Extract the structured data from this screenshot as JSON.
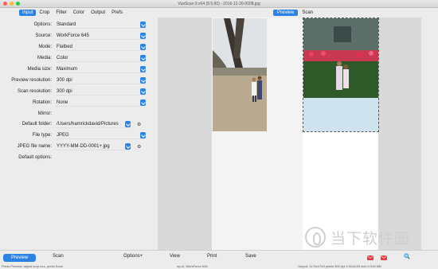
{
  "window": {
    "title": "VueScan 9 x64 (9.5.60) - 2016-12-26-0008.jpg"
  },
  "left_tabs": [
    "Input",
    "Crop",
    "Filter",
    "Color",
    "Output",
    "Prefs"
  ],
  "right_tabs": [
    "Preview",
    "Scan"
  ],
  "fields": [
    {
      "label": "Options:",
      "value": "Standard"
    },
    {
      "label": "Source:",
      "value": "WorkForce 645"
    },
    {
      "label": "Mode:",
      "value": "Flatbed"
    },
    {
      "label": "Media:",
      "value": "Color"
    },
    {
      "label": "Media size:",
      "value": "Maximum"
    },
    {
      "label": "Preview resolution:",
      "value": "300 dpi"
    },
    {
      "label": "Scan resolution:",
      "value": "300 dpi"
    },
    {
      "label": "Rotation:",
      "value": "None"
    },
    {
      "label": "Mirror:",
      "value": ""
    },
    {
      "label": "Default folder:",
      "value": "/Users/hamrickdavid/Pictures"
    },
    {
      "label": "File type:",
      "value": "JPEG"
    },
    {
      "label": "JPEG file name:",
      "value": "YYYY-MM-DD-0001+.jpg"
    },
    {
      "label": "Default options:",
      "value": ""
    }
  ],
  "bottom": {
    "preview": "Preview",
    "scan": "Scan",
    "options": "Options+",
    "view": "View",
    "print": "Print",
    "save": "Save"
  },
  "status": {
    "left": "Press Preview, adjust crop box, press Scan",
    "mid": "mp-6, WorkForce 645",
    "right": "Output: 1176x1749 pixels 300 dpi 3.92x5.83 inch 0.918 MB"
  },
  "watermark": "当下软件园",
  "colors": {
    "accent": "#2b83e6"
  }
}
